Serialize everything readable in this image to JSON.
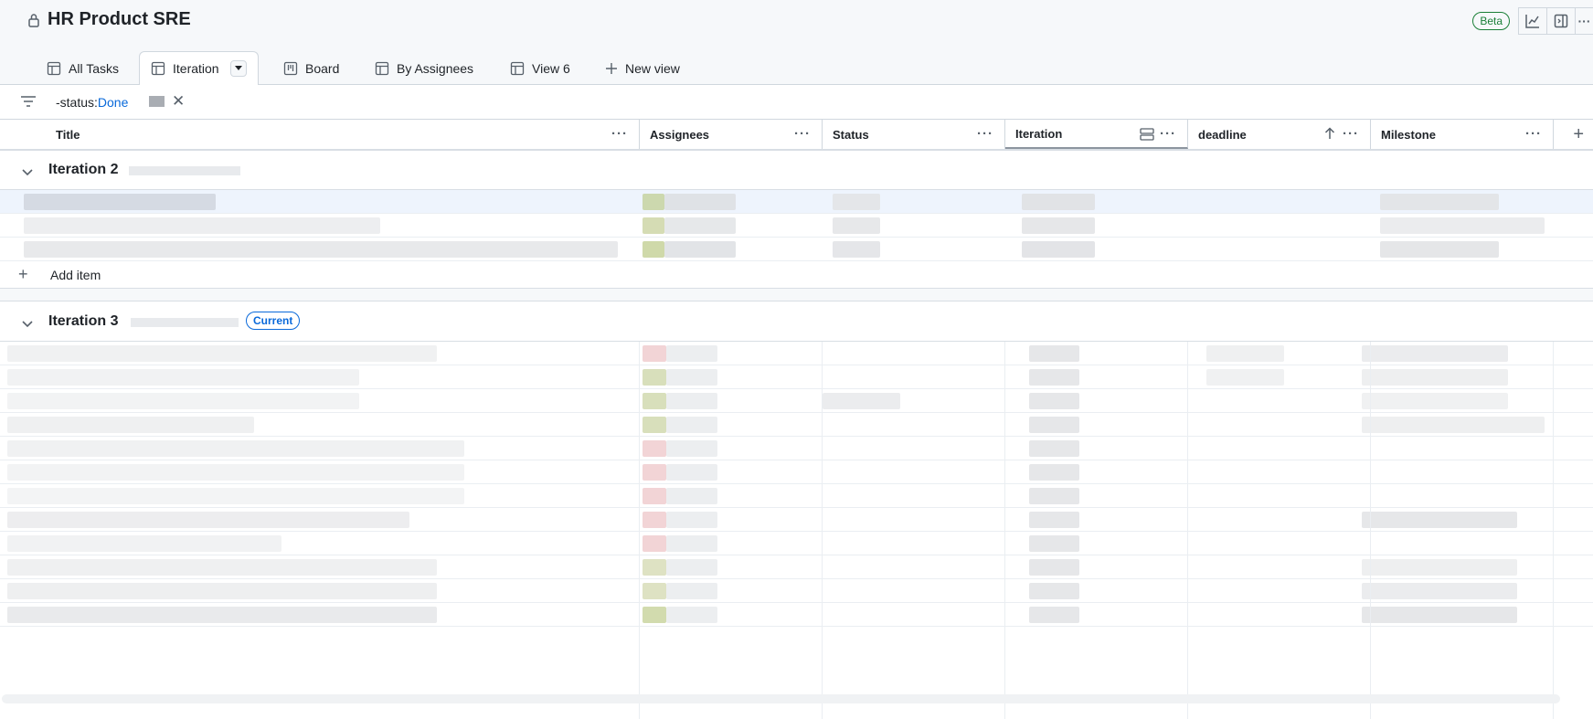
{
  "header": {
    "title": "HR Product SRE",
    "beta_label": "Beta",
    "icons": [
      "lock-icon",
      "insights-icon",
      "side-panel-icon",
      "kebab-icon"
    ]
  },
  "tabs": [
    {
      "label": "All Tasks",
      "icon": "table-icon",
      "active": false
    },
    {
      "label": "Iteration",
      "icon": "table-icon",
      "active": true
    },
    {
      "label": "Board",
      "icon": "board-icon",
      "active": false
    },
    {
      "label": "By Assignees",
      "icon": "table-icon",
      "active": false
    },
    {
      "label": "View 6",
      "icon": "table-icon",
      "active": false
    },
    {
      "label": "New view",
      "icon": "plus-icon",
      "active": false
    }
  ],
  "filter": {
    "key": "-status:",
    "value": "Done",
    "clear_symbol": "✕"
  },
  "columns": [
    {
      "label": "Title"
    },
    {
      "label": "Assignees"
    },
    {
      "label": "Status"
    },
    {
      "label": "Iteration"
    },
    {
      "label": "deadline"
    },
    {
      "label": "Milestone"
    }
  ],
  "groups": [
    {
      "title": "Iteration 2",
      "badge": "",
      "add_item": "Add item"
    },
    {
      "title": "Iteration 3",
      "badge": "Current"
    }
  ],
  "colors": {
    "accent": "#0969da",
    "success": "#1a7f37",
    "border": "#d0d7de"
  }
}
